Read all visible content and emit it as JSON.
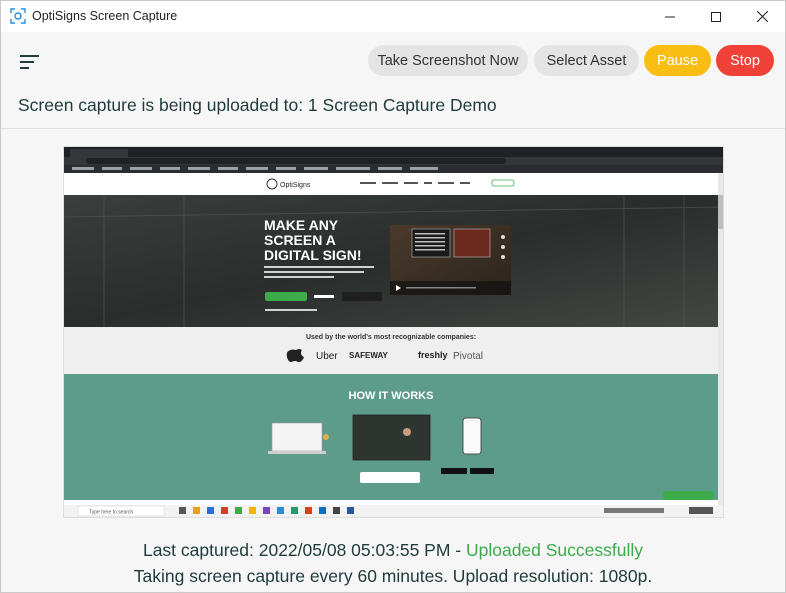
{
  "window": {
    "title": "OptiSigns Screen Capture"
  },
  "toolbar": {
    "take_screenshot": "Take Screenshot Now",
    "select_asset": "Select Asset",
    "pause": "Pause",
    "stop": "Stop"
  },
  "upload": {
    "text": "Screen capture is being uploaded to: 1 Screen Capture Demo"
  },
  "preview": {
    "url": "optisigns.com",
    "brand": "OptiSigns",
    "nav": [
      "Features",
      "Download",
      "Pricing",
      "Apps",
      "Templates",
      "Log In"
    ],
    "hero_title": [
      "MAKE ANY",
      "SCREEN A",
      "DIGITAL SIGN!"
    ],
    "used_by": "Used by the world's most recognizable companies:",
    "logos": [
      "Uber",
      "SAFEWAY",
      "freshly",
      "Pivotal"
    ],
    "section_title": "HOW IT WORKS",
    "taskbar_search": "Type here to search"
  },
  "status": {
    "last_prefix": "Last captured: 2022/05/08 05:03:55 PM - ",
    "last_status": "Uploaded Successfully",
    "schedule": "Taking screen capture every 60 minutes. Upload resolution: 1080p."
  },
  "colors": {
    "pause": "#f9bd14",
    "stop": "#ef4137",
    "success": "#3dab4a",
    "teal_section": "#5e9c8a"
  }
}
